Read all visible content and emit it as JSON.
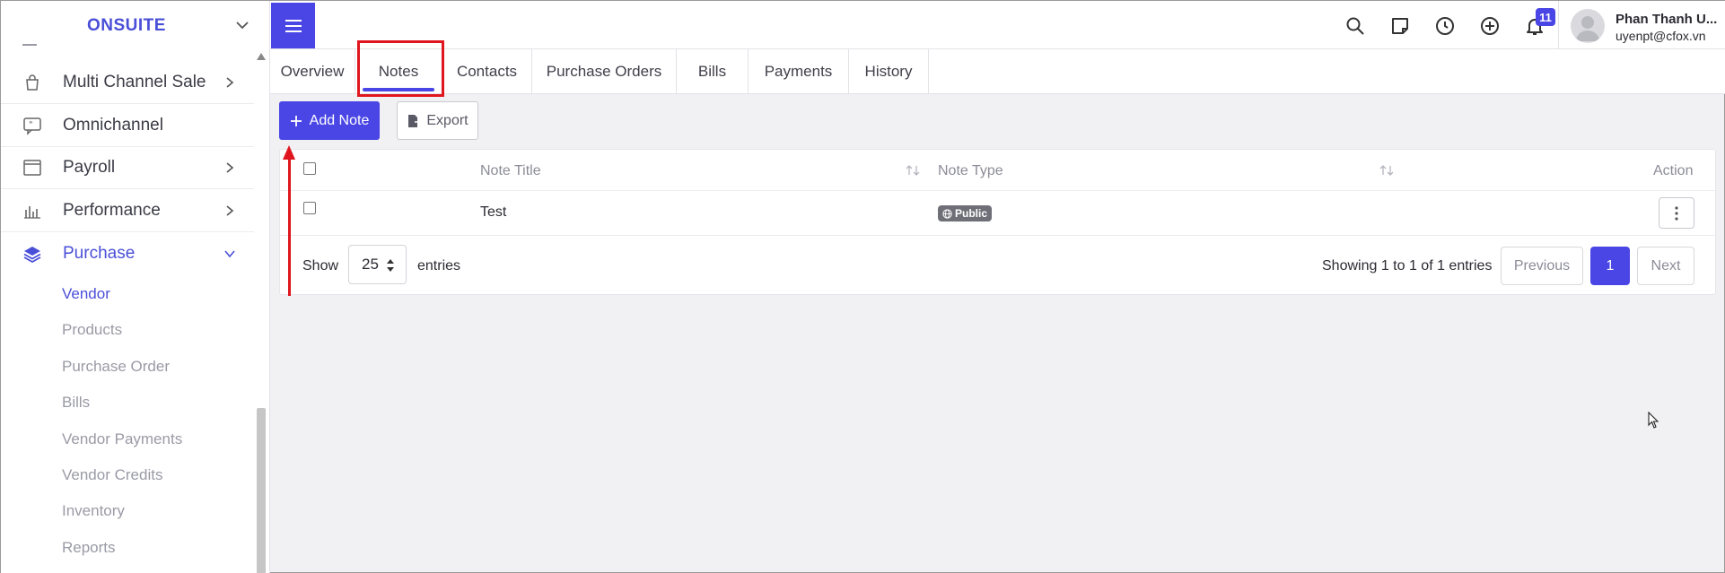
{
  "sidebar": {
    "brand": "ONSUITE",
    "items": [
      {
        "label": "Multi Channel Sale",
        "icon": "bag-icon",
        "has_arrow": true
      },
      {
        "label": "Omnichannel",
        "icon": "chat-quote-icon",
        "has_arrow": false
      },
      {
        "label": "Payroll",
        "icon": "window-icon",
        "has_arrow": true
      },
      {
        "label": "Performance",
        "icon": "bar-chart-icon",
        "has_arrow": true
      },
      {
        "label": "Purchase",
        "icon": "layers-icon",
        "has_arrow": true,
        "expanded": true
      }
    ],
    "sub_items": [
      "Vendor",
      "Products",
      "Purchase Order",
      "Bills",
      "Vendor Payments",
      "Vendor Credits",
      "Inventory",
      "Reports"
    ],
    "active_sub_item": "Vendor"
  },
  "header": {
    "icons": [
      "search-icon",
      "sticky-note-icon",
      "clock-icon",
      "plus-circle-icon",
      "bell-icon"
    ],
    "notification_count": "11",
    "user": {
      "name": "Phan Thanh U...",
      "email": "uyenpt@cfox.vn"
    }
  },
  "tabs": [
    {
      "label": "Overview"
    },
    {
      "label": "Notes",
      "active": true
    },
    {
      "label": "Contacts"
    },
    {
      "label": "Purchase Orders"
    },
    {
      "label": "Bills"
    },
    {
      "label": "Payments"
    },
    {
      "label": "History"
    }
  ],
  "toolbar": {
    "add_label": "Add Note",
    "export_label": "Export"
  },
  "table": {
    "columns": [
      "Note Title",
      "Note Type",
      "Action"
    ],
    "rows": [
      {
        "title": "Test",
        "type": "Public"
      }
    ],
    "footer": {
      "show": "Show",
      "page_length": "25",
      "entries": "entries",
      "info": "Showing 1 to 1 of 1 entries",
      "previous": "Previous",
      "page": "1",
      "next": "Next"
    }
  },
  "colors": {
    "accent": "#4a45e5",
    "annotation": "#e0161f"
  }
}
